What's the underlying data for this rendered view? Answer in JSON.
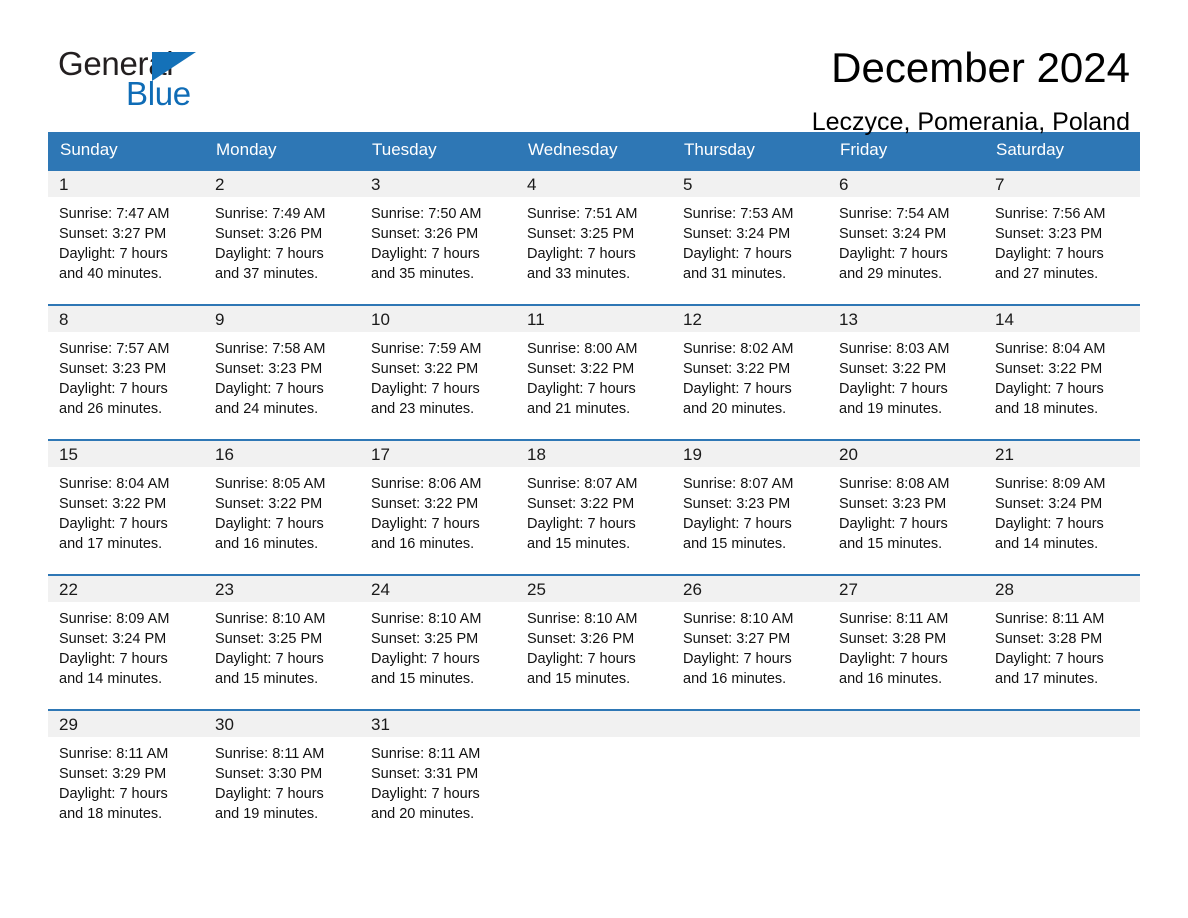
{
  "brand": {
    "name_part1": "General",
    "name_part2": "Blue",
    "logo_icon": "blue-triangle-icon"
  },
  "header": {
    "title": "December 2024",
    "subtitle": "Leczyce, Pomerania, Poland"
  },
  "colors": {
    "header_blue": "#2e77b5",
    "row_separator_blue": "#2e77b5",
    "day_number_bar": "#f1f1f1",
    "brand_blue": "#0f6cb6",
    "text": "#000000"
  },
  "weekday_headers": [
    "Sunday",
    "Monday",
    "Tuesday",
    "Wednesday",
    "Thursday",
    "Friday",
    "Saturday"
  ],
  "weeks": [
    [
      {
        "day": "1",
        "sunrise": "Sunrise: 7:47 AM",
        "sunset": "Sunset: 3:27 PM",
        "daylight_line1": "Daylight: 7 hours",
        "daylight_line2": "and 40 minutes."
      },
      {
        "day": "2",
        "sunrise": "Sunrise: 7:49 AM",
        "sunset": "Sunset: 3:26 PM",
        "daylight_line1": "Daylight: 7 hours",
        "daylight_line2": "and 37 minutes."
      },
      {
        "day": "3",
        "sunrise": "Sunrise: 7:50 AM",
        "sunset": "Sunset: 3:26 PM",
        "daylight_line1": "Daylight: 7 hours",
        "daylight_line2": "and 35 minutes."
      },
      {
        "day": "4",
        "sunrise": "Sunrise: 7:51 AM",
        "sunset": "Sunset: 3:25 PM",
        "daylight_line1": "Daylight: 7 hours",
        "daylight_line2": "and 33 minutes."
      },
      {
        "day": "5",
        "sunrise": "Sunrise: 7:53 AM",
        "sunset": "Sunset: 3:24 PM",
        "daylight_line1": "Daylight: 7 hours",
        "daylight_line2": "and 31 minutes."
      },
      {
        "day": "6",
        "sunrise": "Sunrise: 7:54 AM",
        "sunset": "Sunset: 3:24 PM",
        "daylight_line1": "Daylight: 7 hours",
        "daylight_line2": "and 29 minutes."
      },
      {
        "day": "7",
        "sunrise": "Sunrise: 7:56 AM",
        "sunset": "Sunset: 3:23 PM",
        "daylight_line1": "Daylight: 7 hours",
        "daylight_line2": "and 27 minutes."
      }
    ],
    [
      {
        "day": "8",
        "sunrise": "Sunrise: 7:57 AM",
        "sunset": "Sunset: 3:23 PM",
        "daylight_line1": "Daylight: 7 hours",
        "daylight_line2": "and 26 minutes."
      },
      {
        "day": "9",
        "sunrise": "Sunrise: 7:58 AM",
        "sunset": "Sunset: 3:23 PM",
        "daylight_line1": "Daylight: 7 hours",
        "daylight_line2": "and 24 minutes."
      },
      {
        "day": "10",
        "sunrise": "Sunrise: 7:59 AM",
        "sunset": "Sunset: 3:22 PM",
        "daylight_line1": "Daylight: 7 hours",
        "daylight_line2": "and 23 minutes."
      },
      {
        "day": "11",
        "sunrise": "Sunrise: 8:00 AM",
        "sunset": "Sunset: 3:22 PM",
        "daylight_line1": "Daylight: 7 hours",
        "daylight_line2": "and 21 minutes."
      },
      {
        "day": "12",
        "sunrise": "Sunrise: 8:02 AM",
        "sunset": "Sunset: 3:22 PM",
        "daylight_line1": "Daylight: 7 hours",
        "daylight_line2": "and 20 minutes."
      },
      {
        "day": "13",
        "sunrise": "Sunrise: 8:03 AM",
        "sunset": "Sunset: 3:22 PM",
        "daylight_line1": "Daylight: 7 hours",
        "daylight_line2": "and 19 minutes."
      },
      {
        "day": "14",
        "sunrise": "Sunrise: 8:04 AM",
        "sunset": "Sunset: 3:22 PM",
        "daylight_line1": "Daylight: 7 hours",
        "daylight_line2": "and 18 minutes."
      }
    ],
    [
      {
        "day": "15",
        "sunrise": "Sunrise: 8:04 AM",
        "sunset": "Sunset: 3:22 PM",
        "daylight_line1": "Daylight: 7 hours",
        "daylight_line2": "and 17 minutes."
      },
      {
        "day": "16",
        "sunrise": "Sunrise: 8:05 AM",
        "sunset": "Sunset: 3:22 PM",
        "daylight_line1": "Daylight: 7 hours",
        "daylight_line2": "and 16 minutes."
      },
      {
        "day": "17",
        "sunrise": "Sunrise: 8:06 AM",
        "sunset": "Sunset: 3:22 PM",
        "daylight_line1": "Daylight: 7 hours",
        "daylight_line2": "and 16 minutes."
      },
      {
        "day": "18",
        "sunrise": "Sunrise: 8:07 AM",
        "sunset": "Sunset: 3:22 PM",
        "daylight_line1": "Daylight: 7 hours",
        "daylight_line2": "and 15 minutes."
      },
      {
        "day": "19",
        "sunrise": "Sunrise: 8:07 AM",
        "sunset": "Sunset: 3:23 PM",
        "daylight_line1": "Daylight: 7 hours",
        "daylight_line2": "and 15 minutes."
      },
      {
        "day": "20",
        "sunrise": "Sunrise: 8:08 AM",
        "sunset": "Sunset: 3:23 PM",
        "daylight_line1": "Daylight: 7 hours",
        "daylight_line2": "and 15 minutes."
      },
      {
        "day": "21",
        "sunrise": "Sunrise: 8:09 AM",
        "sunset": "Sunset: 3:24 PM",
        "daylight_line1": "Daylight: 7 hours",
        "daylight_line2": "and 14 minutes."
      }
    ],
    [
      {
        "day": "22",
        "sunrise": "Sunrise: 8:09 AM",
        "sunset": "Sunset: 3:24 PM",
        "daylight_line1": "Daylight: 7 hours",
        "daylight_line2": "and 14 minutes."
      },
      {
        "day": "23",
        "sunrise": "Sunrise: 8:10 AM",
        "sunset": "Sunset: 3:25 PM",
        "daylight_line1": "Daylight: 7 hours",
        "daylight_line2": "and 15 minutes."
      },
      {
        "day": "24",
        "sunrise": "Sunrise: 8:10 AM",
        "sunset": "Sunset: 3:25 PM",
        "daylight_line1": "Daylight: 7 hours",
        "daylight_line2": "and 15 minutes."
      },
      {
        "day": "25",
        "sunrise": "Sunrise: 8:10 AM",
        "sunset": "Sunset: 3:26 PM",
        "daylight_line1": "Daylight: 7 hours",
        "daylight_line2": "and 15 minutes."
      },
      {
        "day": "26",
        "sunrise": "Sunrise: 8:10 AM",
        "sunset": "Sunset: 3:27 PM",
        "daylight_line1": "Daylight: 7 hours",
        "daylight_line2": "and 16 minutes."
      },
      {
        "day": "27",
        "sunrise": "Sunrise: 8:11 AM",
        "sunset": "Sunset: 3:28 PM",
        "daylight_line1": "Daylight: 7 hours",
        "daylight_line2": "and 16 minutes."
      },
      {
        "day": "28",
        "sunrise": "Sunrise: 8:11 AM",
        "sunset": "Sunset: 3:28 PM",
        "daylight_line1": "Daylight: 7 hours",
        "daylight_line2": "and 17 minutes."
      }
    ],
    [
      {
        "day": "29",
        "sunrise": "Sunrise: 8:11 AM",
        "sunset": "Sunset: 3:29 PM",
        "daylight_line1": "Daylight: 7 hours",
        "daylight_line2": "and 18 minutes."
      },
      {
        "day": "30",
        "sunrise": "Sunrise: 8:11 AM",
        "sunset": "Sunset: 3:30 PM",
        "daylight_line1": "Daylight: 7 hours",
        "daylight_line2": "and 19 minutes."
      },
      {
        "day": "31",
        "sunrise": "Sunrise: 8:11 AM",
        "sunset": "Sunset: 3:31 PM",
        "daylight_line1": "Daylight: 7 hours",
        "daylight_line2": "and 20 minutes."
      },
      {
        "day": "",
        "sunrise": "",
        "sunset": "",
        "daylight_line1": "",
        "daylight_line2": ""
      },
      {
        "day": "",
        "sunrise": "",
        "sunset": "",
        "daylight_line1": "",
        "daylight_line2": ""
      },
      {
        "day": "",
        "sunrise": "",
        "sunset": "",
        "daylight_line1": "",
        "daylight_line2": ""
      },
      {
        "day": "",
        "sunrise": "",
        "sunset": "",
        "daylight_line1": "",
        "daylight_line2": ""
      }
    ]
  ]
}
